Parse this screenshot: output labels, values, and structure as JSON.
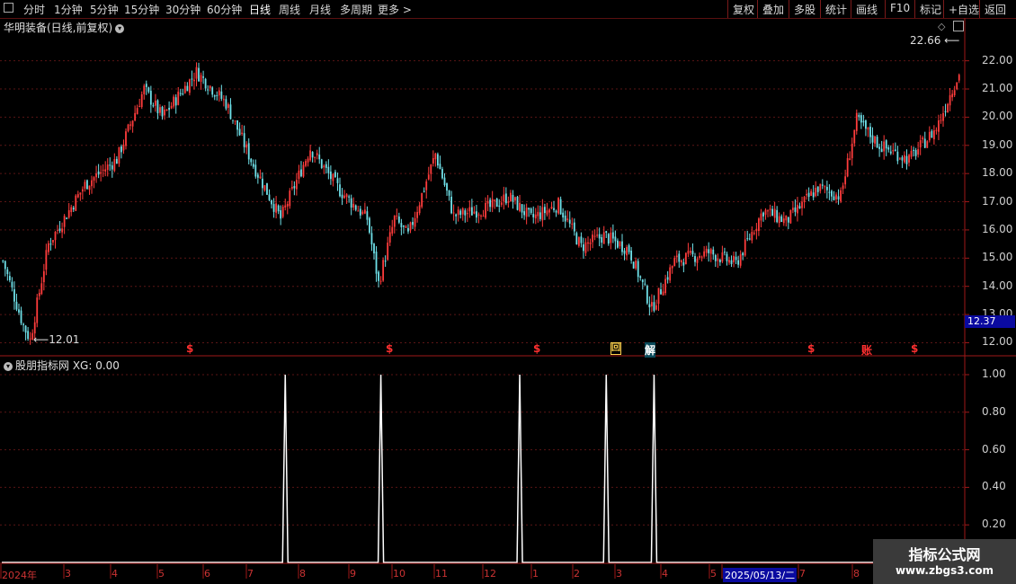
{
  "toolbar": {
    "left_items": [
      "分时",
      "1分钟",
      "5分钟",
      "15分钟",
      "30分钟",
      "60分钟",
      "日线",
      "周线",
      "月线",
      "多周期",
      "更多 >"
    ],
    "active_index": 6,
    "right_items": [
      "复权",
      "叠加",
      "多股",
      "统计",
      "画线",
      "F10",
      "标记",
      "+自选",
      "返回"
    ]
  },
  "header": {
    "stock_title": "华明装备(日线,前复权)",
    "indicator_title": "股朋指标网 XG: 0.00"
  },
  "markers": {
    "high_label": "22.66",
    "low_label": "12.01",
    "current_price": "12.37",
    "signals": [
      {
        "label": "$",
        "x": 212,
        "color": "#ff3030"
      },
      {
        "label": "$",
        "x": 434,
        "color": "#ff3030"
      },
      {
        "label": "$",
        "x": 598,
        "color": "#ff3030"
      },
      {
        "label": "回",
        "x": 684,
        "color": "#ffd24d"
      },
      {
        "label": "解",
        "x": 722,
        "color": "#30c0d0"
      },
      {
        "label": "$",
        "x": 903,
        "color": "#ff3030"
      },
      {
        "label": "账",
        "x": 963,
        "color": "#ff3030"
      },
      {
        "label": "$",
        "x": 1018,
        "color": "#ff3030"
      }
    ]
  },
  "x_axis": {
    "labels": [
      "2024年",
      "3",
      "4",
      "5",
      "6",
      "7",
      "8",
      "9",
      "10",
      "11",
      "12",
      "1",
      "2",
      "3",
      "4",
      "5",
      "2025/05/13/二",
      "7",
      "8"
    ]
  },
  "colors": {
    "up": "#ff3c3c",
    "down": "#6fe0e8",
    "grid": "#5a1515",
    "axis": "#a01818",
    "signal": "#ffffff"
  },
  "chart_data": [
    {
      "type": "candlestick",
      "title": "华明装备(日线,前复权)",
      "y_ticks": [
        "22.00",
        "21.00",
        "20.00",
        "19.00",
        "18.00",
        "17.00",
        "16.00",
        "15.00",
        "14.00",
        "13.00",
        "12.00"
      ],
      "ylim": [
        11.6,
        23.2
      ],
      "grid": true,
      "anchors": [
        {
          "i": 0,
          "close": 14.9
        },
        {
          "i": 9,
          "close": 12.6
        },
        {
          "i": 12,
          "close": 12.1
        },
        {
          "i": 20,
          "close": 15.5
        },
        {
          "i": 36,
          "close": 17.6
        },
        {
          "i": 50,
          "close": 18.5
        },
        {
          "i": 62,
          "close": 21.0
        },
        {
          "i": 70,
          "close": 20.0
        },
        {
          "i": 85,
          "close": 21.6
        },
        {
          "i": 98,
          "close": 20.5
        },
        {
          "i": 110,
          "close": 18.3
        },
        {
          "i": 122,
          "close": 16.4
        },
        {
          "i": 135,
          "close": 18.9
        },
        {
          "i": 148,
          "close": 17.4
        },
        {
          "i": 160,
          "close": 16.4
        },
        {
          "i": 165,
          "close": 14.1
        },
        {
          "i": 172,
          "close": 16.4
        },
        {
          "i": 178,
          "close": 15.8
        },
        {
          "i": 190,
          "close": 18.7
        },
        {
          "i": 198,
          "close": 16.5
        },
        {
          "i": 214,
          "close": 16.8
        },
        {
          "i": 222,
          "close": 17.2
        },
        {
          "i": 232,
          "close": 16.4
        },
        {
          "i": 244,
          "close": 16.9
        },
        {
          "i": 254,
          "close": 15.4
        },
        {
          "i": 264,
          "close": 15.8
        },
        {
          "i": 275,
          "close": 15.3
        },
        {
          "i": 285,
          "close": 13.2
        },
        {
          "i": 295,
          "close": 14.9
        },
        {
          "i": 310,
          "close": 15.2
        },
        {
          "i": 322,
          "close": 14.8
        },
        {
          "i": 334,
          "close": 16.7
        },
        {
          "i": 344,
          "close": 16.3
        },
        {
          "i": 358,
          "close": 17.5
        },
        {
          "i": 368,
          "close": 17.2
        },
        {
          "i": 375,
          "close": 19.9
        },
        {
          "i": 385,
          "close": 19.0
        },
        {
          "i": 398,
          "close": 18.5
        },
        {
          "i": 410,
          "close": 19.6
        },
        {
          "i": 418,
          "close": 21.2
        },
        {
          "i": 420,
          "close": 21.5
        }
      ],
      "candle_count": 421
    },
    {
      "type": "line",
      "series": [
        {
          "name": "XG",
          "spikes_at_candle": [
            124,
            166,
            227,
            265,
            286
          ]
        }
      ],
      "y_ticks": [
        "1.00",
        "0.80",
        "0.60",
        "0.40",
        "0.20"
      ],
      "ylim": [
        0,
        1
      ],
      "grid": true
    }
  ],
  "watermark": {
    "line1": "指标公式网",
    "line2": "www.zbgs3.com"
  }
}
